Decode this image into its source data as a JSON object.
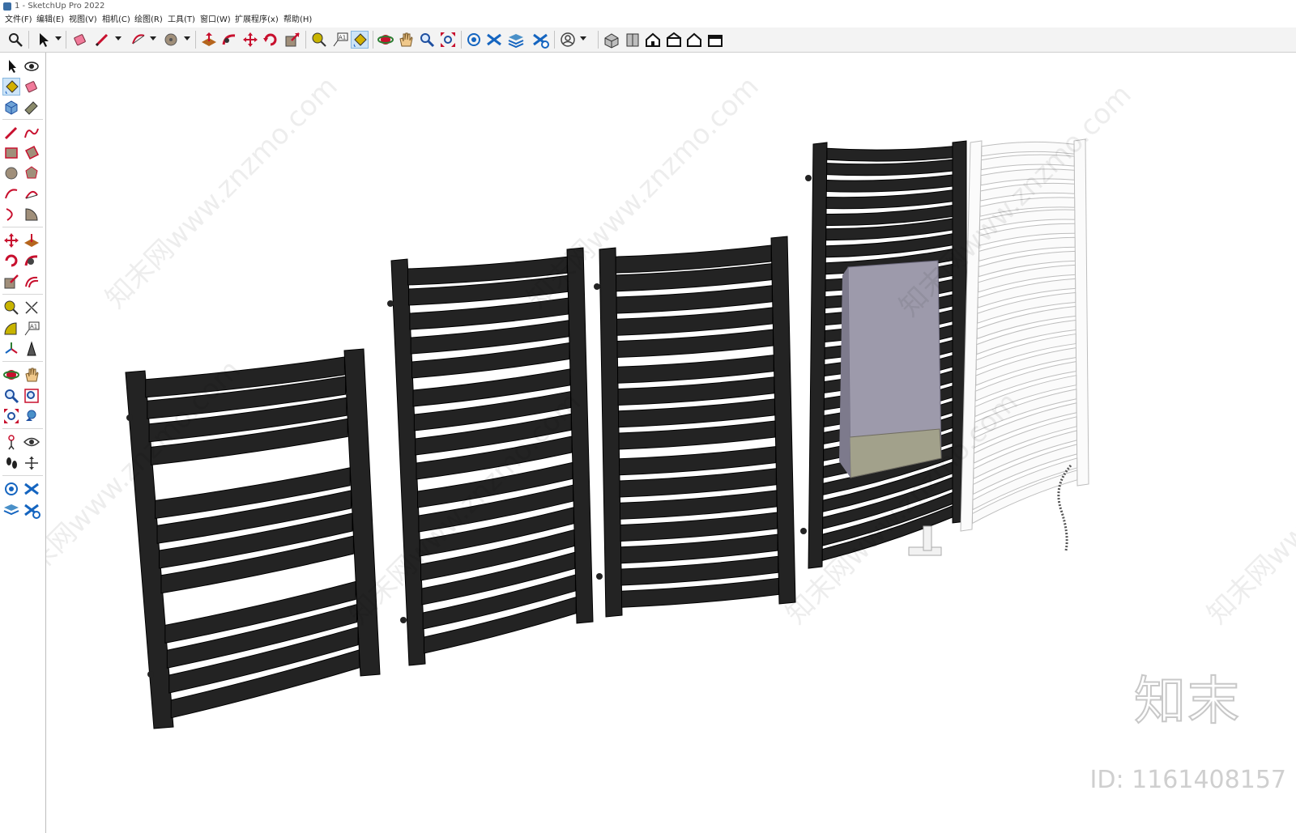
{
  "window": {
    "title": "1 - SketchUp Pro 2022"
  },
  "menu": [
    "文件(F)",
    "编辑(E)",
    "视图(V)",
    "相机(C)",
    "绘图(R)",
    "工具(T)",
    "窗口(W)",
    "扩展程序(x)",
    "帮助(H)"
  ],
  "toolbar_icons": [
    "search-icon",
    "select-arrow-icon",
    "eraser-icon",
    "pencil-icon",
    "arc-icon",
    "circle-icon",
    "push-pull-icon",
    "follow-me-icon",
    "move-icon",
    "rotate-icon",
    "scale-icon",
    "tape-measure-icon",
    "text-label-icon",
    "paint-bucket-icon",
    "orbit-icon",
    "pan-icon",
    "zoom-icon",
    "zoom-extents-icon",
    "warehouse-icon",
    "extension-warehouse-icon",
    "layer-icon",
    "sandbox-icon",
    "account-icon",
    "iso-view-icon",
    "front-view-icon",
    "top-view-icon",
    "house-icon",
    "right-view-icon",
    "back-view-icon"
  ],
  "left_tools": [
    "select-icon",
    "orbit-icon",
    "paint-bucket-icon",
    "eraser-icon",
    "component-icon",
    "tag-icon",
    "pencil-icon",
    "freehand-icon",
    "rectangle-icon",
    "rotated-rectangle-icon",
    "circle-icon",
    "polygon-icon",
    "arc-icon",
    "two-point-arc-icon",
    "three-point-arc-icon",
    "pie-icon",
    "move-icon",
    "push-pull-icon",
    "rotate-icon",
    "follow-me-icon",
    "scale-icon",
    "offset-icon",
    "tape-measure-icon",
    "dimension-icon",
    "protractor-icon",
    "text-icon",
    "axes-icon",
    "3d-text-icon",
    "orbit-icon",
    "pan-icon",
    "zoom-icon",
    "zoom-window-icon",
    "zoom-extents-icon",
    "previous-view-icon",
    "position-camera-icon",
    "look-around-icon",
    "walk-icon",
    "section-plane-icon",
    "warehouse-icon",
    "sandbox-icon",
    "layer-icon",
    "extension-icon"
  ],
  "watermarks": [
    "知末网www.znzmo.com",
    "知末网www.znzmo.com",
    "知末网www.znzmo.com",
    "知末网www.znzmo.com",
    "知末网www.znzmo.com",
    "知末网www.znzmo.com",
    "知末网www.znzmo.com"
  ],
  "brand": "知末",
  "model_id": "ID: 1161408157",
  "colors": {
    "rail": "#232323",
    "rail_edge": "#000000",
    "white_rail": "#fbfbfb",
    "towel": "#9d9aab",
    "towel_band": "#a2a18b",
    "toolbar_bg": "#f3f3f3",
    "active": "#cde4f7"
  }
}
